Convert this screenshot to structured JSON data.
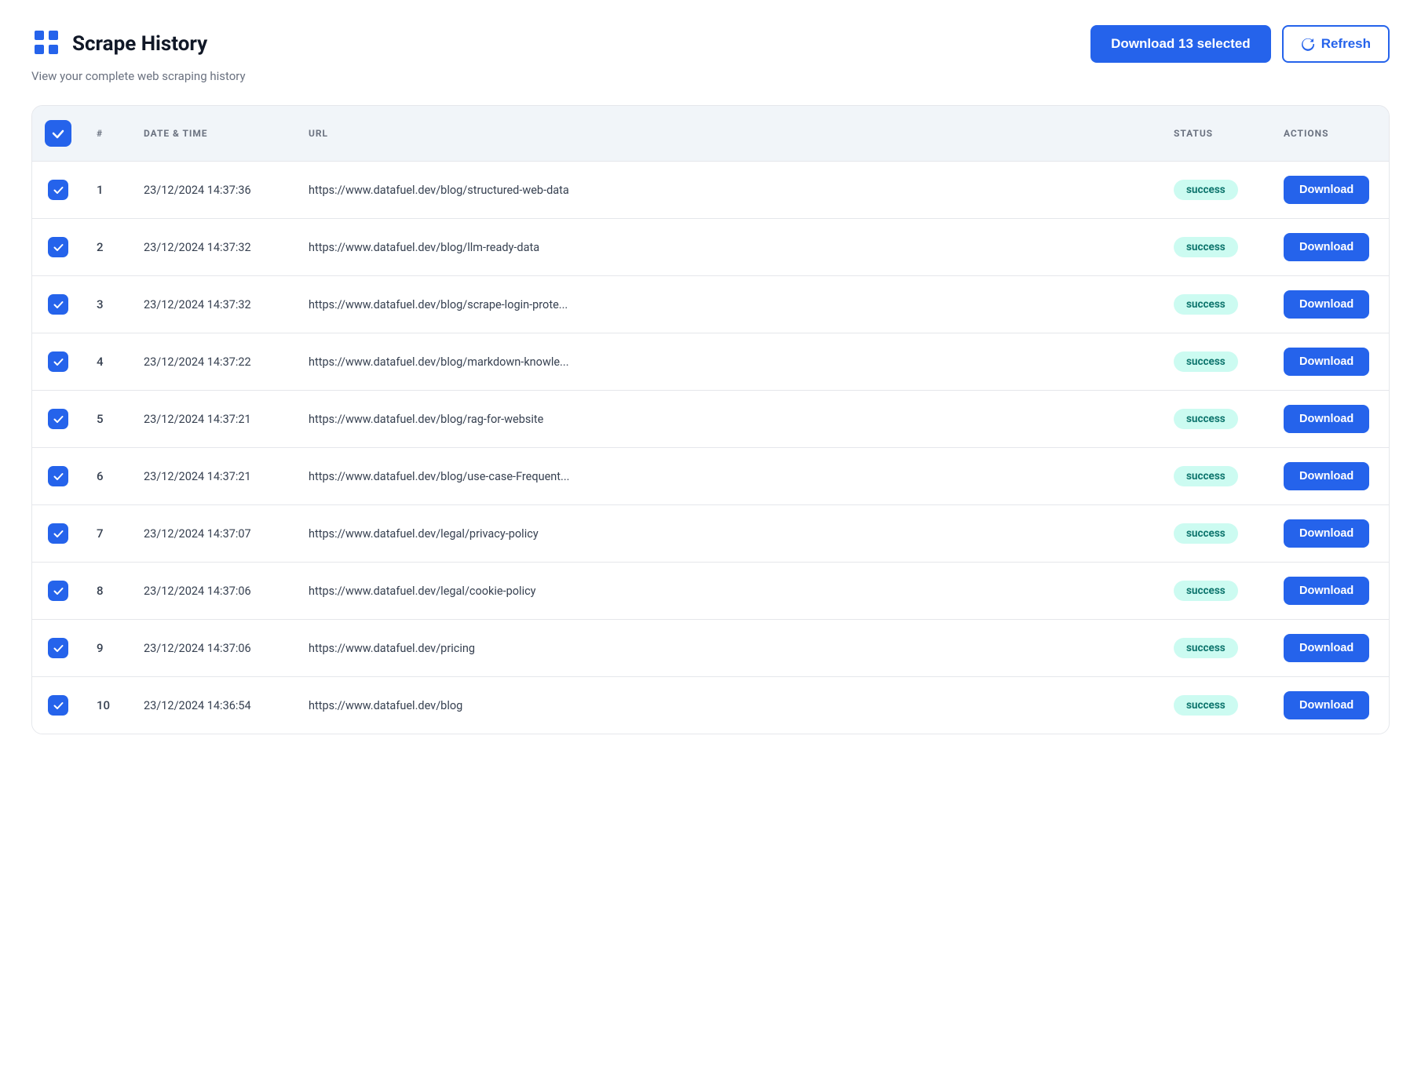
{
  "header": {
    "title": "Scrape History",
    "subtitle": "View your complete web scraping history",
    "download_selected_label": "Download 13 selected",
    "refresh_label": "Refresh"
  },
  "table": {
    "columns": {
      "check": "",
      "num": "#",
      "date": "DATE & TIME",
      "url": "URL",
      "status": "STATUS",
      "actions": "ACTIONS"
    },
    "rows": [
      {
        "id": 1,
        "num": "1",
        "date": "23/12/2024 14:37:36",
        "url": "https://www.datafuel.dev/blog/structured-web-data",
        "status": "success",
        "action": "Download"
      },
      {
        "id": 2,
        "num": "2",
        "date": "23/12/2024 14:37:32",
        "url": "https://www.datafuel.dev/blog/llm-ready-data",
        "status": "success",
        "action": "Download"
      },
      {
        "id": 3,
        "num": "3",
        "date": "23/12/2024 14:37:32",
        "url": "https://www.datafuel.dev/blog/scrape-login-prote...",
        "status": "success",
        "action": "Download"
      },
      {
        "id": 4,
        "num": "4",
        "date": "23/12/2024 14:37:22",
        "url": "https://www.datafuel.dev/blog/markdown-knowle...",
        "status": "success",
        "action": "Download"
      },
      {
        "id": 5,
        "num": "5",
        "date": "23/12/2024 14:37:21",
        "url": "https://www.datafuel.dev/blog/rag-for-website",
        "status": "success",
        "action": "Download"
      },
      {
        "id": 6,
        "num": "6",
        "date": "23/12/2024 14:37:21",
        "url": "https://www.datafuel.dev/blog/use-case-Frequent...",
        "status": "success",
        "action": "Download"
      },
      {
        "id": 7,
        "num": "7",
        "date": "23/12/2024 14:37:07",
        "url": "https://www.datafuel.dev/legal/privacy-policy",
        "status": "success",
        "action": "Download"
      },
      {
        "id": 8,
        "num": "8",
        "date": "23/12/2024 14:37:06",
        "url": "https://www.datafuel.dev/legal/cookie-policy",
        "status": "success",
        "action": "Download"
      },
      {
        "id": 9,
        "num": "9",
        "date": "23/12/2024 14:37:06",
        "url": "https://www.datafuel.dev/pricing",
        "status": "success",
        "action": "Download"
      },
      {
        "id": 10,
        "num": "10",
        "date": "23/12/2024 14:36:54",
        "url": "https://www.datafuel.dev/blog",
        "status": "success",
        "action": "Download"
      }
    ]
  }
}
